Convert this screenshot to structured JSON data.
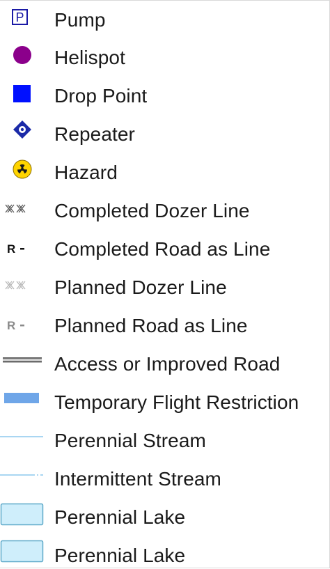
{
  "legend": {
    "items": [
      {
        "label": "Pump",
        "icon": "pump-icon",
        "letter": "P",
        "color": "#1a1aa6"
      },
      {
        "label": "Helispot",
        "icon": "helispot-icon",
        "color": "#8b008b"
      },
      {
        "label": "Drop Point",
        "icon": "drop-point-icon",
        "color": "#0010ff"
      },
      {
        "label": "Repeater",
        "icon": "repeater-icon",
        "color": "#1b2aa8"
      },
      {
        "label": "Hazard",
        "icon": "hazard-icon",
        "color": "#ffd400"
      },
      {
        "label": "Completed Dozer Line",
        "icon": "completed-dozer-line-icon",
        "color": "#555555"
      },
      {
        "label": "Completed Road as Line",
        "icon": "completed-road-line-icon",
        "letter": "R",
        "color": "#111111"
      },
      {
        "label": "Planned Dozer Line",
        "icon": "planned-dozer-line-icon",
        "color": "#b8b8b8"
      },
      {
        "label": "Planned Road as Line",
        "icon": "planned-road-line-icon",
        "letter": "R",
        "color": "#8a8a8a"
      },
      {
        "label": "Access or Improved Road",
        "icon": "access-road-icon",
        "color": "#6b6b6b"
      },
      {
        "label": "Temporary Flight Restriction",
        "icon": "tfr-icon",
        "color": "#6fa6e8"
      },
      {
        "label": "Perennial Stream",
        "icon": "perennial-stream-icon",
        "color": "#a9d6f2"
      },
      {
        "label": "Intermittent Stream",
        "icon": "intermittent-stream-icon",
        "color": "#a9d6f2"
      },
      {
        "label": "Perennial Lake",
        "icon": "perennial-lake-icon",
        "color": "#cfeefb"
      },
      {
        "label": "Perennial Lake",
        "icon": "perennial-lake-icon",
        "color": "#cfeefb"
      }
    ]
  }
}
